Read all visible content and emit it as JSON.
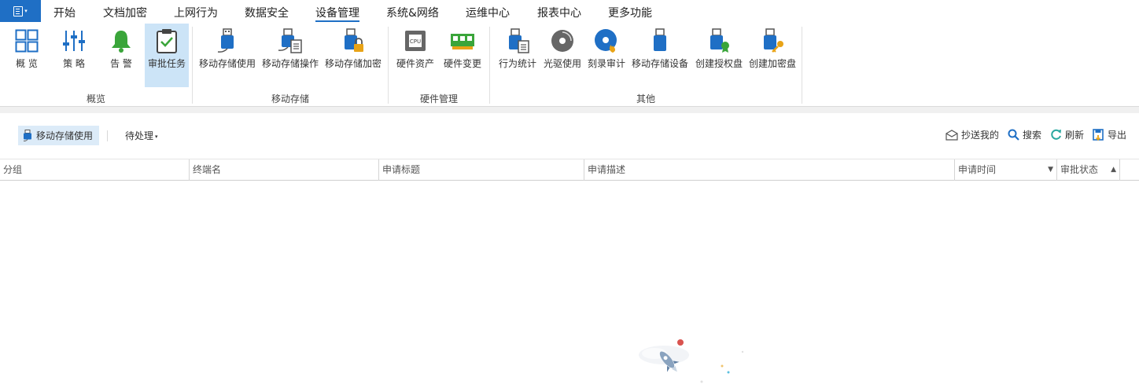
{
  "menubar": {
    "tabs": [
      {
        "label": "开始"
      },
      {
        "label": "文档加密"
      },
      {
        "label": "上网行为"
      },
      {
        "label": "数据安全"
      },
      {
        "label": "设备管理"
      },
      {
        "label": "系统&网络"
      },
      {
        "label": "运维中心"
      },
      {
        "label": "报表中心"
      },
      {
        "label": "更多功能"
      }
    ],
    "active_tab": "设备管理"
  },
  "ribbon": {
    "groups": [
      {
        "label": "概览"
      },
      {
        "label": "移动存储"
      },
      {
        "label": "硬件管理"
      },
      {
        "label": "其他"
      }
    ],
    "buttons": [
      {
        "label": "概 览",
        "icon": "grid-icon"
      },
      {
        "label": "策 略",
        "icon": "sliders-icon"
      },
      {
        "label": "告 警",
        "icon": "bell-icon"
      },
      {
        "label": "审批任务",
        "icon": "clipboard-check-icon",
        "selected": true
      },
      {
        "label": "移动存储使用",
        "icon": "usb-icon"
      },
      {
        "label": "移动存储操作",
        "icon": "usb-log-icon"
      },
      {
        "label": "移动存储加密",
        "icon": "usb-lock-icon"
      },
      {
        "label": "硬件资产",
        "icon": "cpu-icon"
      },
      {
        "label": "硬件变更",
        "icon": "memory-icon"
      },
      {
        "label": "行为统计",
        "icon": "usb-stats-icon"
      },
      {
        "label": "光驱使用",
        "icon": "disc-icon"
      },
      {
        "label": "刻录审计",
        "icon": "disc-burn-icon"
      },
      {
        "label": "移动存储设备",
        "icon": "usb-device-icon"
      },
      {
        "label": "创建授权盘",
        "icon": "usb-auth-icon"
      },
      {
        "label": "创建加密盘",
        "icon": "usb-key-icon"
      }
    ]
  },
  "toolbar": {
    "current_view": "移动存储使用",
    "filter": "待处理",
    "actions": [
      {
        "label": "抄送我的",
        "icon": "mail-icon"
      },
      {
        "label": "搜索",
        "icon": "search-icon"
      },
      {
        "label": "刷新",
        "icon": "refresh-icon"
      },
      {
        "label": "导出",
        "icon": "export-icon"
      }
    ]
  },
  "table": {
    "columns": [
      {
        "label": "分组"
      },
      {
        "label": "终端名"
      },
      {
        "label": "申请标题"
      },
      {
        "label": "申请描述"
      },
      {
        "label": "申请时间",
        "sort": "desc"
      },
      {
        "label": "审批状态",
        "sort": "asc"
      }
    ],
    "rows": []
  },
  "colors": {
    "accent": "#1f6fc5",
    "selected_bg": "#cce4f7",
    "alert_green": "#3aa53a"
  }
}
